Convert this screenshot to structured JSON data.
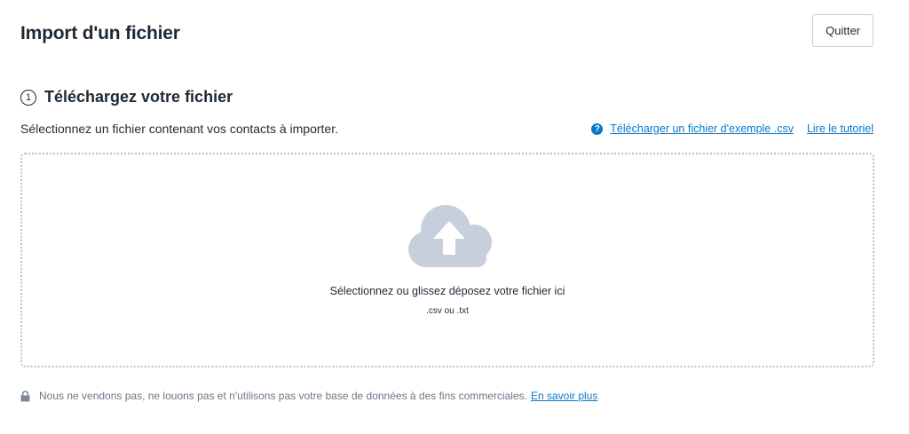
{
  "header": {
    "title": "Import d'un fichier",
    "quit_label": "Quitter"
  },
  "step": {
    "number": "1",
    "title": "Téléchargez votre fichier",
    "description": "Sélectionnez un fichier contenant vos contacts à importer."
  },
  "links": {
    "sample_csv": "Télécharger un fichier d'exemple .csv",
    "tutorial": "Lire le tutoriel"
  },
  "dropzone": {
    "instruction": "Sélectionnez ou glissez déposez votre fichier ici",
    "formats": ".csv ou .txt"
  },
  "footer": {
    "privacy_text": "Nous ne vendons pas, ne louons pas et n'utilisons pas votre base de données à des fins commerciales.",
    "learn_more": "En savoir plus"
  },
  "colors": {
    "link": "#0a79c9",
    "cloud": "#c6cfdb",
    "dropzone_border": "#b5c3d3"
  },
  "icons": {
    "step": "circled-number-icon",
    "help": "question-circle-icon",
    "upload": "cloud-upload-icon",
    "lock": "lock-icon"
  }
}
